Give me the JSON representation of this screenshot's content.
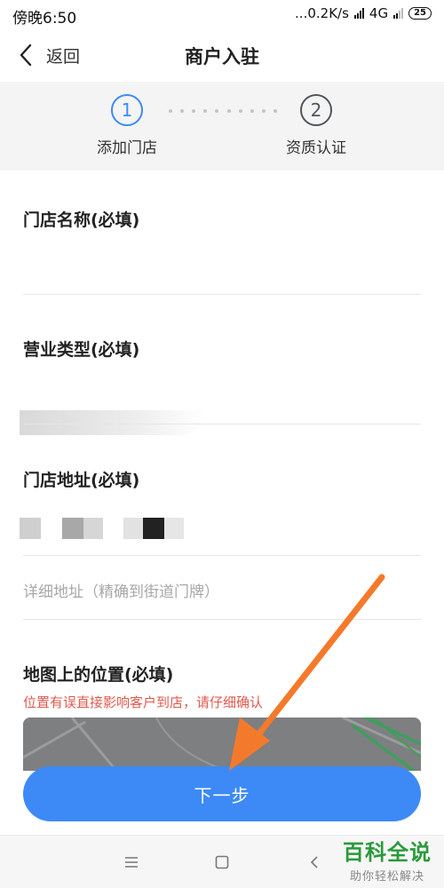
{
  "status_bar": {
    "time": "傍晚6:50",
    "net_speed": "...0.2K/s",
    "network": "4G",
    "battery": "25"
  },
  "header": {
    "back_label": "返回",
    "title": "商户入驻"
  },
  "steps": [
    {
      "number": "1",
      "label": "添加门店",
      "active": true
    },
    {
      "number": "2",
      "label": "资质认证",
      "active": false
    }
  ],
  "form": {
    "store_name_label": "门店名称(必填)",
    "store_name_value": "",
    "business_type_label": "营业类型(必填)",
    "address_label": "门店地址(必填)",
    "detail_address_placeholder": "详细地址（精确到街道门牌）",
    "map_label": "地图上的位置(必填)",
    "map_warning": "位置有误直接影响客户到店，请仔细确认"
  },
  "next_button": "下一步",
  "nav_icons": [
    "menu-icon",
    "home-square-icon",
    "back-chevron-icon"
  ],
  "watermark": {
    "main": "百科全说",
    "sub": "助你轻松解决"
  },
  "colors": {
    "primary": "#3d8af7",
    "warning": "#e05a4f",
    "annotation_arrow": "#f47a2b",
    "watermark": "#2a9a3a"
  }
}
